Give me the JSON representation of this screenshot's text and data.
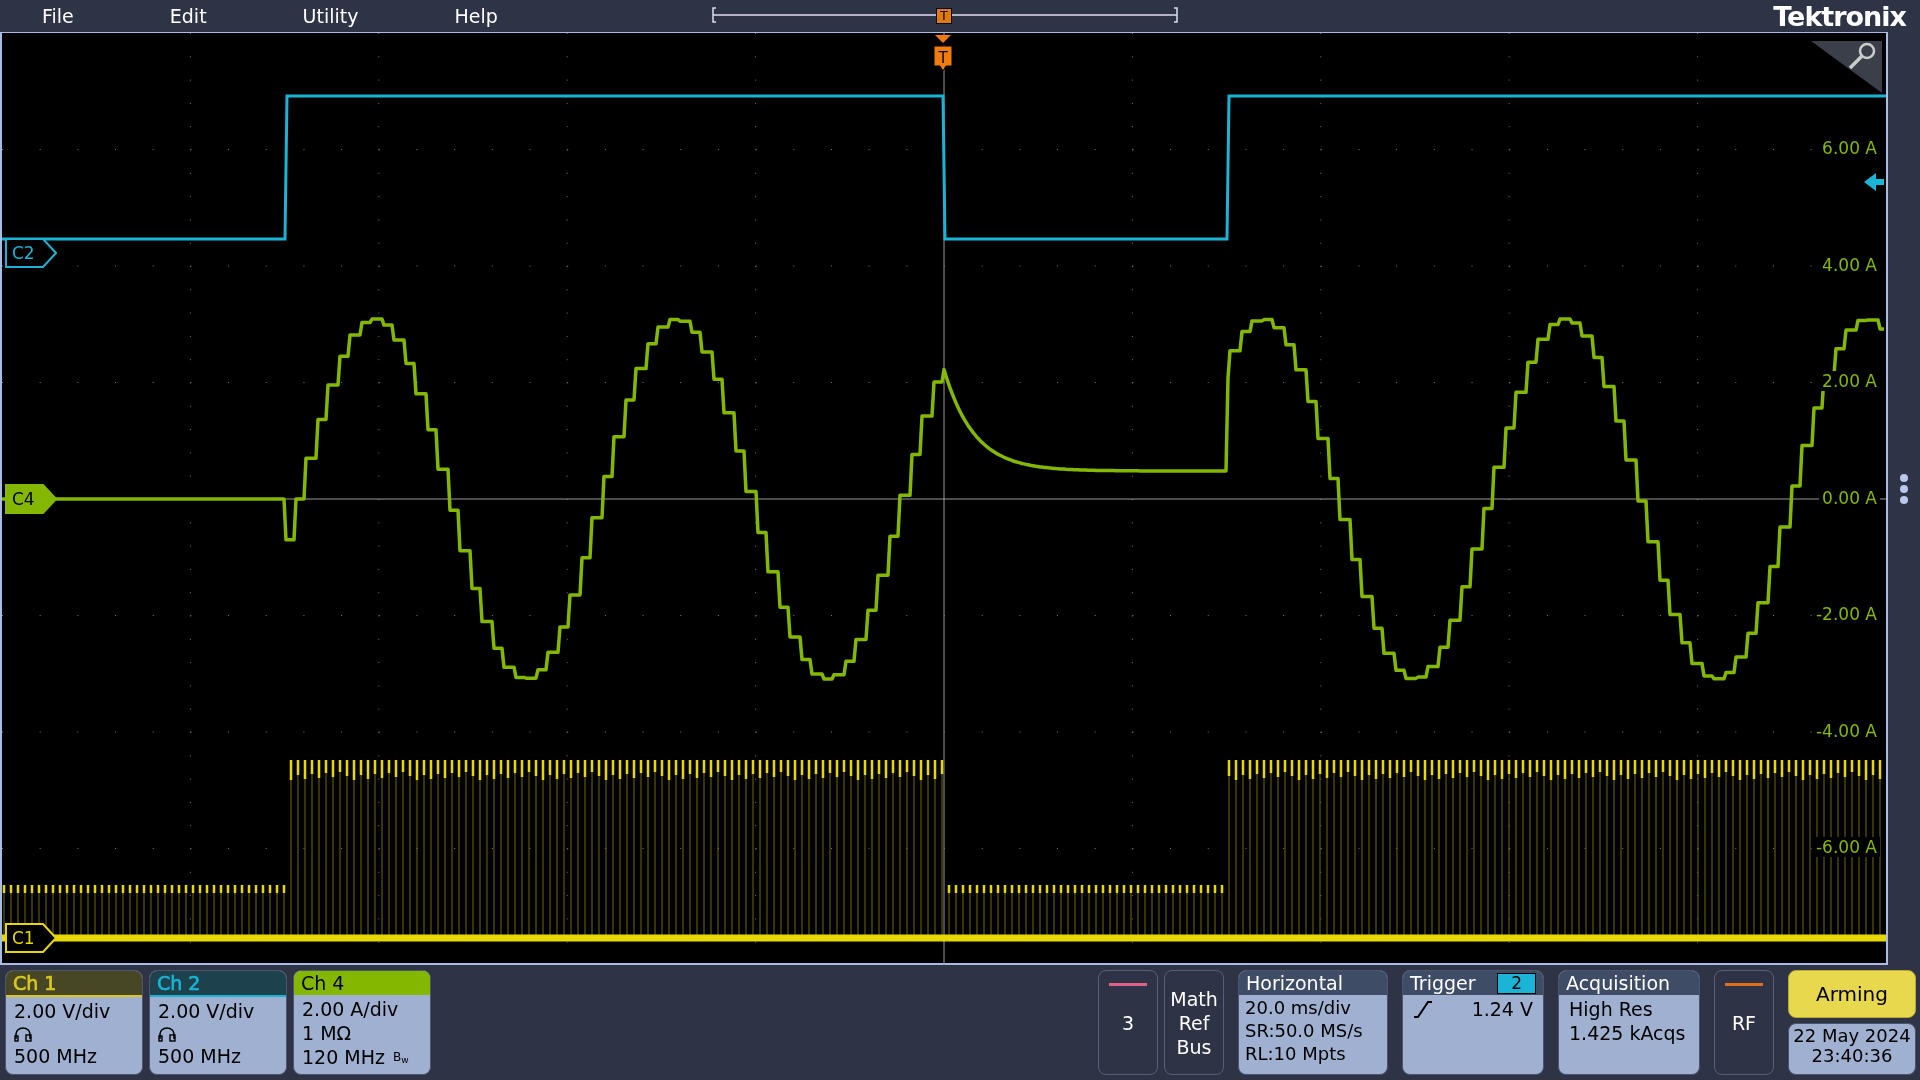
{
  "menu": [
    {
      "label": "File"
    },
    {
      "label": "Edit"
    },
    {
      "label": "Utility"
    },
    {
      "label": "Help"
    }
  ],
  "timeline": {
    "marker": "T"
  },
  "brand": "Tektronix",
  "plot": {
    "trigger_marker": "T",
    "scale_labels": [
      "6.00 A",
      "4.00 A",
      "2.00 A",
      "0.00 A",
      "-2.00 A",
      "-4.00 A",
      "-6.00 A"
    ],
    "markers": [
      {
        "label": "C2",
        "color": "#1ab4d6",
        "selected": false
      },
      {
        "label": "C4",
        "color": "#84b800",
        "selected": true
      },
      {
        "label": "C1",
        "color": "#e6d800",
        "selected": false
      }
    ]
  },
  "channels": [
    {
      "title": "Ch 1",
      "color": "#d8c820",
      "selected": false,
      "rows": [
        {
          "kind": "text",
          "text": "2.00 V/div"
        },
        {
          "kind": "probe"
        },
        {
          "kind": "text",
          "text": "500 MHz"
        }
      ]
    },
    {
      "title": "Ch 2",
      "color": "#1ab4d6",
      "selected": false,
      "rows": [
        {
          "kind": "text",
          "text": "2.00 V/div"
        },
        {
          "kind": "probe"
        },
        {
          "kind": "text",
          "text": "500 MHz"
        }
      ]
    },
    {
      "title": "Ch 4",
      "color": "#84b800",
      "selected": true,
      "rows": [
        {
          "kind": "text",
          "text": "2.00 A/div"
        },
        {
          "kind": "text",
          "text": "1 MΩ"
        },
        {
          "kind": "bw",
          "text": "120 MHz",
          "mark": "B$_{w}$"
        }
      ]
    }
  ],
  "ch3_tile": {
    "label": "3",
    "color": "#e0608c"
  },
  "math_tile": {
    "lines": [
      "Math",
      "Ref",
      "Bus"
    ]
  },
  "horizontal": {
    "title": "Horizontal",
    "lines": [
      "20.0 ms/div",
      "SR:50.0 MS/s",
      "RL:10 Mpts"
    ]
  },
  "trigger": {
    "title": "Trigger",
    "source": {
      "label": "2",
      "color": "#1ab4d6"
    },
    "value": "1.24 V"
  },
  "acquisition": {
    "title": "Acquisition",
    "lines": [
      "High Res",
      "1.425 kAcqs"
    ]
  },
  "rf_tile": {
    "label": "RF",
    "color": "#e07020"
  },
  "run_button": {
    "label": "Arming"
  },
  "datetime": {
    "date": "22 May 2024",
    "time": "23:40:36"
  }
}
